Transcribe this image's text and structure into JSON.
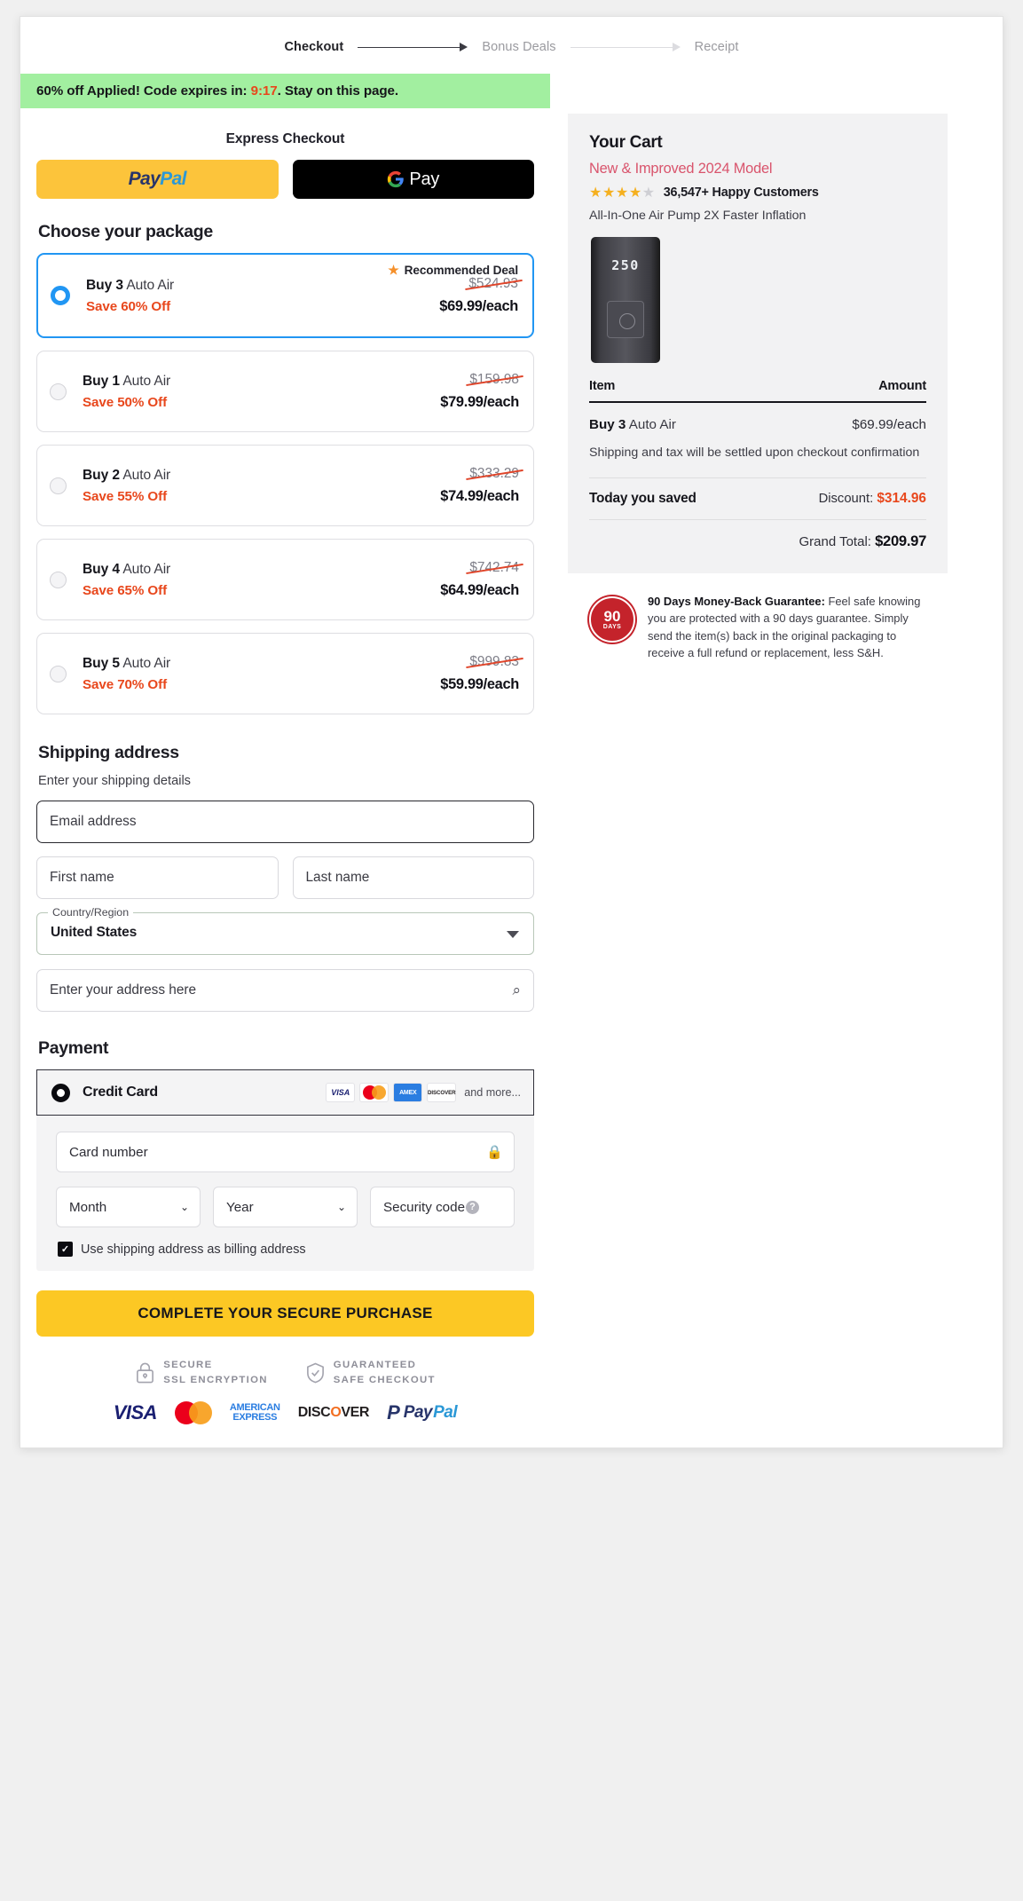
{
  "stepper": {
    "steps": [
      {
        "label": "Checkout",
        "active": true
      },
      {
        "label": "Bonus Deals",
        "active": false
      },
      {
        "label": "Receipt",
        "active": false
      }
    ]
  },
  "promo": {
    "prefix": "60% off Applied! Code expires in: ",
    "timer": "9:17",
    "suffix": ". Stay on this page."
  },
  "express": {
    "title": "Express Checkout",
    "paypal": {
      "part1": "Pay",
      "part2": "Pal"
    },
    "gpay": {
      "g": "G",
      "pay": "Pay"
    }
  },
  "packages": {
    "heading": "Choose your package",
    "recommended_badge": "Recommended Deal",
    "items": [
      {
        "qty_label": "Buy 3",
        "product": "Auto Air",
        "save": "Save 60% Off",
        "old_price": "$524.93",
        "price": "$69.99/each",
        "selected": true,
        "recommended": true
      },
      {
        "qty_label": "Buy 1",
        "product": "Auto Air",
        "save": "Save 50% Off",
        "old_price": "$159.98",
        "price": "$79.99/each",
        "selected": false,
        "recommended": false
      },
      {
        "qty_label": "Buy 2",
        "product": "Auto Air",
        "save": "Save 55% Off",
        "old_price": "$333.29",
        "price": "$74.99/each",
        "selected": false,
        "recommended": false
      },
      {
        "qty_label": "Buy 4",
        "product": "Auto Air",
        "save": "Save 65% Off",
        "old_price": "$742.74",
        "price": "$64.99/each",
        "selected": false,
        "recommended": false
      },
      {
        "qty_label": "Buy 5",
        "product": "Auto Air",
        "save": "Save 70% Off",
        "old_price": "$999.83",
        "price": "$59.99/each",
        "selected": false,
        "recommended": false
      }
    ]
  },
  "shipping": {
    "heading": "Shipping address",
    "subheading": "Enter your shipping details",
    "email_placeholder": "Email address",
    "first_name_placeholder": "First name",
    "last_name_placeholder": "Last name",
    "country_legend": "Country/Region",
    "country_value": "United States",
    "address_placeholder": "Enter your address here",
    "search_icon": "search-icon"
  },
  "payment": {
    "heading": "Payment",
    "method_label": "Credit Card",
    "brands": [
      "VISA",
      "mastercard",
      "AMEX",
      "DISCOVER"
    ],
    "and_more": "and more...",
    "card_number_placeholder": "Card number",
    "lock_icon": "lock-icon",
    "month_label": "Month",
    "year_label": "Year",
    "security_code_label": "Security code",
    "help_icon": "help-icon",
    "billing_checkbox_label": "Use shipping address as billing address",
    "billing_checked": true
  },
  "cta": {
    "label": "COMPLETE YOUR SECURE PURCHASE"
  },
  "trust": {
    "badges": [
      {
        "icon": "lock-icon",
        "line1": "SECURE",
        "line2": "SSL ENCRYPTION"
      },
      {
        "icon": "shield-check-icon",
        "line1": "GUARANTEED",
        "line2": "SAFE CHECKOUT"
      }
    ],
    "cards": {
      "visa": "VISA",
      "mastercard": "mastercard",
      "amex_line1": "AMERICAN",
      "amex_line2": "EXPRESS",
      "discover_pre": "DISC",
      "discover_o": "O",
      "discover_post": "VER",
      "paypal_mark": "P",
      "paypal_t1": "Pay",
      "paypal_t2": "Pal"
    }
  },
  "cart": {
    "title": "Your Cart",
    "model": "New & Improved 2024 Model",
    "stars": "★★★★",
    "half_star": "★",
    "customers": "36,547+ Happy Customers",
    "description": "All-In-One Air Pump 2X Faster Inflation",
    "product_display": "250",
    "col_item": "Item",
    "col_amount": "Amount",
    "item_qty": "Buy 3",
    "item_product": "Auto Air",
    "item_amount": "$69.99/each",
    "note": "Shipping and tax will be settled upon checkout confirmation",
    "saved_label": "Today you saved",
    "discount_label": "Discount: ",
    "discount_value": "$314.96",
    "grand_label": "Grand Total: ",
    "grand_value": "$209.97"
  },
  "guarantee": {
    "seal_number": "90",
    "seal_unit": "DAYS",
    "title": "90 Days Money-Back Guarantee:",
    "body": " Feel safe knowing you are protected with a 90 days guarantee. Simply send the item(s) back in the original packaging to receive a full refund or replacement, less S&H."
  },
  "colors": {
    "promo_bg": "#a2efa0",
    "timer": "#e8471c",
    "accent_blue": "#2196f3",
    "save_orange": "#e8471c",
    "cta_yellow": "#fcc824",
    "paypal_yellow": "#fcc43b",
    "model_pink": "#d9546c",
    "star_gold": "#f5b01f"
  }
}
